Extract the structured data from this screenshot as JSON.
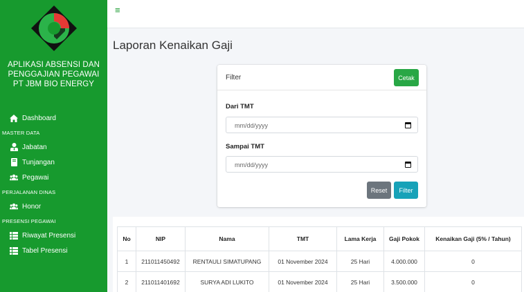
{
  "sidebar": {
    "title_lines": [
      "APLIKASI ABSENSI DAN",
      "PENGGAJIAN PEGAWAI",
      "PT JBM BIO ENERGY"
    ],
    "dashboard": "Dashboard",
    "section_master": "MASTER DATA",
    "jabatan": "Jabatan",
    "tunjangan": "Tunjangan",
    "pegawai": "Pegawai",
    "section_perjalanan": "PERJALANAN DINAS",
    "honor": "Honor",
    "section_presensi": "PRESENSI PEGAWAI",
    "riwayat": "Riwayat Presensi",
    "tabel": "Tabel Presensi"
  },
  "topbar": {
    "menu_icon": "≡"
  },
  "page": {
    "title": "Laporan Kenaikan Gaji"
  },
  "filter": {
    "header": "Filter",
    "cetak": "Cetak",
    "dari_label": "Dari TMT",
    "dari_placeholder": "mm/dd/yyyy",
    "sampai_label": "Sampai TMT",
    "sampai_placeholder": "mm/dd/yyyy",
    "reset": "Reset",
    "filter": "Filter"
  },
  "table": {
    "headers": [
      "No",
      "NIP",
      "Nama",
      "TMT",
      "Lama Kerja",
      "Gaji Pokok",
      "Kenaikan Gaji (5% / Tahun)"
    ],
    "rows": [
      [
        "1",
        "211011450492",
        "RENTAULI SIMATUPANG",
        "01 November 2024",
        "25 Hari",
        "4.000.000",
        "0"
      ],
      [
        "2",
        "211011401692",
        "SURYA ADI LUKITO",
        "01 November 2024",
        "25 Hari",
        "3.500.000",
        "0"
      ]
    ]
  },
  "colors": {
    "sidebar": "#179a2e",
    "cetak": "#28a745",
    "reset": "#6c757d",
    "filter": "#17a2b8"
  },
  "icons": [
    "home-icon",
    "user-tie-icon",
    "book-icon",
    "users-icon",
    "list-icon"
  ]
}
